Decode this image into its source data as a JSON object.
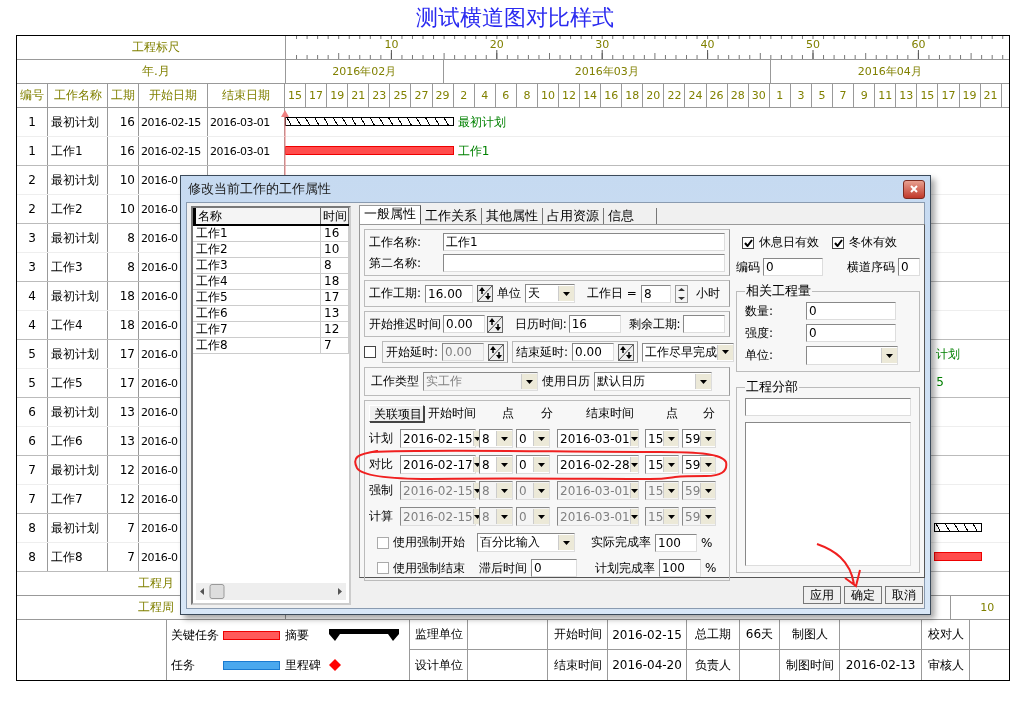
{
  "title": "测试横道图对比样式",
  "gantt": {
    "ruler_label": "工程标尺",
    "ruler_ticks": [
      "10",
      "20",
      "30",
      "40",
      "50",
      "60"
    ],
    "month_label": "年.月",
    "months": [
      "2016年02月",
      "2016年03月",
      "2016年04月"
    ],
    "columns": [
      "编号",
      "工作名称",
      "工期",
      "开始日期",
      "结束日期"
    ],
    "days": [
      "15",
      "17",
      "19",
      "21",
      "23",
      "25",
      "27",
      "29",
      "2",
      "4",
      "6",
      "8",
      "10",
      "12",
      "14",
      "16",
      "18",
      "20",
      "22",
      "24",
      "26",
      "28",
      "30",
      "1",
      "3",
      "5",
      "7",
      "9",
      "11",
      "13",
      "15",
      "17",
      "19",
      "21"
    ],
    "rows": [
      {
        "kind": "plan",
        "number": "1",
        "name": "最初计划",
        "duration": "16",
        "start": "2016-02-15",
        "end": "2016-03-01",
        "bar_label": "最初计划"
      },
      {
        "kind": "actual",
        "number": "1",
        "name": "工作1",
        "duration": "16",
        "start": "2016-02-15",
        "end": "2016-03-01",
        "bar_label": "工作1"
      },
      {
        "kind": "plan",
        "number": "2",
        "name": "最初计划",
        "duration": "10",
        "start": "2016-0"
      },
      {
        "kind": "actual",
        "number": "2",
        "name": "工作2",
        "duration": "10",
        "start": "2016-0"
      },
      {
        "kind": "plan",
        "number": "3",
        "name": "最初计划",
        "duration": "8",
        "start": "2016-0"
      },
      {
        "kind": "actual",
        "number": "3",
        "name": "工作3",
        "duration": "8",
        "start": "2016-0"
      },
      {
        "kind": "plan",
        "number": "4",
        "name": "最初计划",
        "duration": "18",
        "start": "2016-0"
      },
      {
        "kind": "actual",
        "number": "4",
        "name": "工作4",
        "duration": "18",
        "start": "2016-0"
      },
      {
        "kind": "plan",
        "number": "5",
        "name": "最初计划",
        "duration": "17",
        "start": "2016-0",
        "bar_label": "计划"
      },
      {
        "kind": "actual",
        "number": "5",
        "name": "工作5",
        "duration": "17",
        "start": "2016-0",
        "bar_label": "5"
      },
      {
        "kind": "plan",
        "number": "6",
        "name": "最初计划",
        "duration": "13",
        "start": "2016-0"
      },
      {
        "kind": "actual",
        "number": "6",
        "name": "工作6",
        "duration": "13",
        "start": "2016-0"
      },
      {
        "kind": "plan",
        "number": "7",
        "name": "最初计划",
        "duration": "12",
        "start": "2016-0"
      },
      {
        "kind": "actual",
        "number": "7",
        "name": "工作7",
        "duration": "12",
        "start": "2016-0"
      },
      {
        "kind": "plan",
        "number": "8",
        "name": "最初计划",
        "duration": "7",
        "start": "2016-0"
      },
      {
        "kind": "actual",
        "number": "8",
        "name": "工作8",
        "duration": "7",
        "start": "2016-0"
      }
    ],
    "month_row_label": "工程月",
    "week_row_label": "工程周",
    "week_numbers": [
      "10"
    ],
    "legend": [
      {
        "kind": "critical",
        "label": "关键任务"
      },
      {
        "kind": "summary",
        "label": "摘要"
      },
      {
        "kind": "task",
        "label": "任务"
      },
      {
        "kind": "milestone",
        "label": "里程碑"
      }
    ],
    "info_rows": [
      [
        {
          "label": "监理单位"
        },
        {
          "label": "开始时间",
          "value": "2016-02-15"
        },
        {
          "label": "总工期",
          "value": "66天"
        },
        {
          "label": "制图人"
        },
        {
          "label": "校对人"
        }
      ],
      [
        {
          "label": "设计单位"
        },
        {
          "label": "结束时间",
          "value": "2016-04-20"
        },
        {
          "label": "负责人"
        },
        {
          "label": "制图时间",
          "value": "2016-02-13"
        },
        {
          "label": "审核人"
        }
      ]
    ]
  },
  "dialog": {
    "title": "修改当前工作的工作属性",
    "list": {
      "columns": [
        "名称",
        "时间"
      ],
      "rows": [
        [
          "工作1",
          "16"
        ],
        [
          "工作2",
          "10"
        ],
        [
          "工作3",
          "8"
        ],
        [
          "工作4",
          "18"
        ],
        [
          "工作5",
          "17"
        ],
        [
          "工作6",
          "13"
        ],
        [
          "工作7",
          "12"
        ],
        [
          "工作8",
          "7"
        ]
      ]
    },
    "tabs": [
      {
        "label": "一般属性",
        "selected": true
      },
      {
        "label": "工作关系",
        "selected": false
      },
      {
        "label": "其他属性",
        "selected": false
      },
      {
        "label": "占用资源",
        "selected": false
      },
      {
        "label": "信息",
        "selected": false
      }
    ],
    "work_name": {
      "label": "工作名称:",
      "value": "工作1"
    },
    "second_name": {
      "label": "第二名称:"
    },
    "duration": {
      "label": "工作工期:",
      "value": "16.00"
    },
    "unit": {
      "label": "单位",
      "value": "天"
    },
    "workday": {
      "label": "工作日 =",
      "value": "8",
      "suffix": "小时"
    },
    "start_delay_time": {
      "label": "开始推迟时间",
      "value": "0.00"
    },
    "calendar_time": {
      "label": "日历时间:",
      "value": "16"
    },
    "remaining": {
      "label": "剩余工期:"
    },
    "delay_enabled": {
      "checked": false
    },
    "start_delay": {
      "label": "开始延时:",
      "value": "0.00",
      "disabled": true
    },
    "end_delay": {
      "label": "结束延时:",
      "value": "0.00"
    },
    "constraint": {
      "value": "工作尽早完成"
    },
    "work_type": {
      "label": "工作类型",
      "value": "实工作",
      "disabled": true
    },
    "calendar": {
      "label": "使用日历",
      "value": "默认日历"
    },
    "schedule": {
      "button": "关联项目",
      "headers": [
        "开始时间",
        "点",
        "分",
        "结束时间",
        "点",
        "分"
      ],
      "rows": [
        {
          "label": "计划",
          "disabled": false,
          "values": [
            "2016-02-15",
            "8",
            "0",
            "2016-03-01",
            "15",
            "59"
          ]
        },
        {
          "label": "对比",
          "disabled": false,
          "values": [
            "2016-02-17",
            "8",
            "0",
            "2016-02-28",
            "15",
            "59"
          ]
        },
        {
          "label": "强制",
          "disabled": true,
          "values": [
            "2016-02-15",
            "8",
            "0",
            "2016-03-01",
            "15",
            "59"
          ]
        },
        {
          "label": "计算",
          "disabled": true,
          "values": [
            "2016-02-15",
            "8",
            "0",
            "2016-03-01",
            "15",
            "59"
          ]
        }
      ]
    },
    "force_start": {
      "label": "使用强制开始",
      "checked": false
    },
    "input_mode": {
      "value": "百分比输入"
    },
    "actual_rate": {
      "label": "实际完成率",
      "value": "100",
      "unit": "%"
    },
    "force_end": {
      "label": "使用强制结束",
      "checked": false
    },
    "lag": {
      "label": "滞后时间",
      "value": "0"
    },
    "plan_rate": {
      "label": "计划完成率",
      "value": "100",
      "unit": "%"
    },
    "right_checks": [
      {
        "label": "休息日有效",
        "checked": true
      },
      {
        "label": "冬休有效",
        "checked": true
      }
    ],
    "code": {
      "label": "编码",
      "value": "0"
    },
    "lane": {
      "label": "横道序码",
      "value": "0"
    },
    "quantity": {
      "title": "相关工程量",
      "fields": [
        {
          "kind": "text",
          "label": "数量:",
          "value": "0"
        },
        {
          "kind": "text",
          "label": "强度:",
          "value": "0"
        },
        {
          "kind": "select",
          "label": "单位:"
        }
      ]
    },
    "division": {
      "title": "工程分部"
    },
    "buttons": [
      "应用",
      "确定",
      "取消"
    ]
  }
}
